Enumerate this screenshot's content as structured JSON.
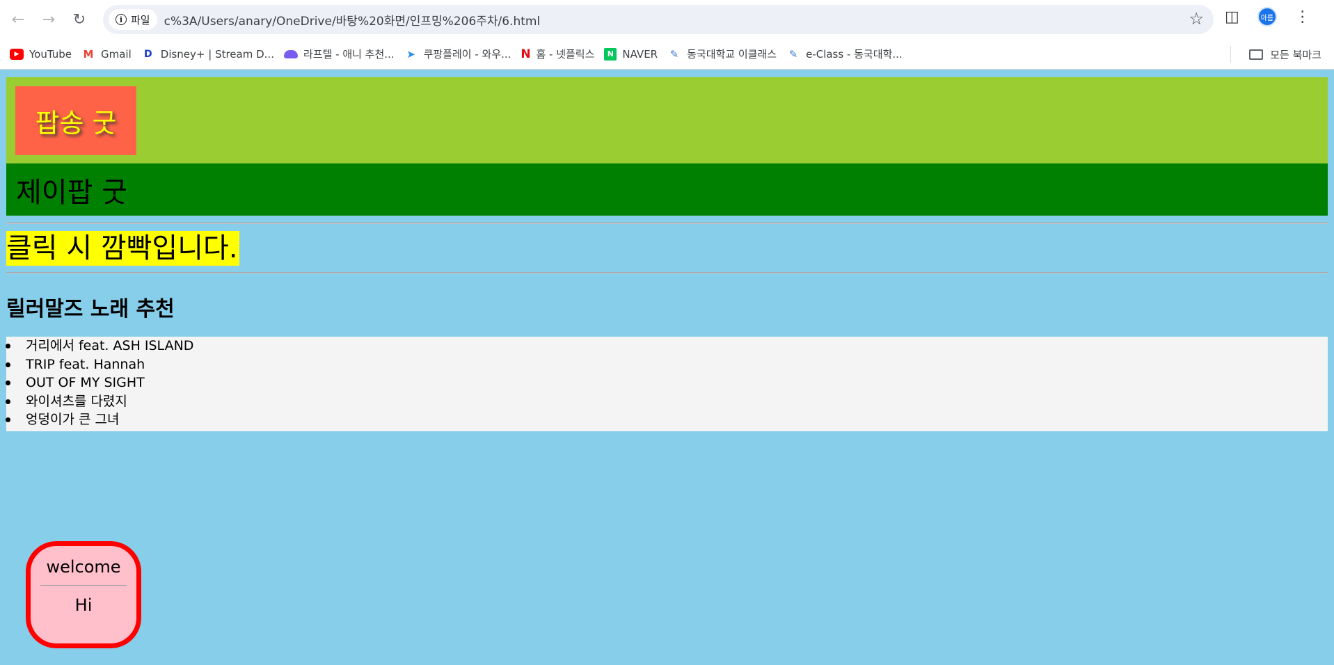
{
  "browser": {
    "site_chip_label": "파일",
    "url": "c%3A/Users/anary/OneDrive/바탕%20화면/인프밍%206주차/6.html",
    "avatar_label": "아름",
    "icons": {
      "back": "back-arrow-icon",
      "forward": "forward-arrow-icon",
      "reload": "reload-icon",
      "info": "info-icon",
      "star": "star-icon",
      "extensions": "puzzle-icon",
      "menu": "kebab-menu-icon"
    }
  },
  "bookmarks": {
    "items": [
      {
        "label": "YouTube",
        "icon": "youtube-icon",
        "color": "#ff0000"
      },
      {
        "label": "Gmail",
        "icon": "gmail-icon",
        "color": "#ea4335"
      },
      {
        "label": "Disney+ | Stream D...",
        "icon": "disney-icon",
        "color": "#1a3cc8"
      },
      {
        "label": "라프텔 - 애니 추천...",
        "icon": "laftel-icon",
        "color": "#7b5cf0"
      },
      {
        "label": "쿠팡플레이 - 와우...",
        "icon": "coupangplay-icon",
        "color": "#2a8ef5"
      },
      {
        "label": "홈 - 넷플릭스",
        "icon": "netflix-icon",
        "color": "#e50914"
      },
      {
        "label": "NAVER",
        "icon": "naver-icon",
        "color": "#03c75a"
      },
      {
        "label": "동국대학교 이클래스",
        "icon": "document-edit-icon",
        "color": "#4a7bd6"
      },
      {
        "label": "e-Class - 동국대학...",
        "icon": "document-edit-icon",
        "color": "#4a7bd6"
      }
    ],
    "all_bookmarks_label": "모든 북마크"
  },
  "page": {
    "logo_text": "팝송 굿",
    "subheader_text": "제이팝 굿",
    "blink_text": "클릭 시 깜빡입니다.",
    "section_title": "릴러말즈 노래 추천",
    "songs": [
      "거리에서 feat. ASH ISLAND",
      "TRIP feat. Hannah",
      "OUT OF MY SIGHT",
      "와이셔츠를 다렸지",
      "엉덩이가 큰 그녀"
    ],
    "welcome_text": "welcome",
    "hi_text": "Hi"
  },
  "colors": {
    "page_bg": "#87ceeb",
    "header_bg": "#9acd32",
    "logo_bg": "#ff6347",
    "logo_text": "#ffff00",
    "subheader_bg": "#008000",
    "blink_bg": "#ffff00",
    "list_bg": "#f4f4f4",
    "welcome_bg": "#ffc0cb",
    "welcome_border": "#ff0000"
  }
}
